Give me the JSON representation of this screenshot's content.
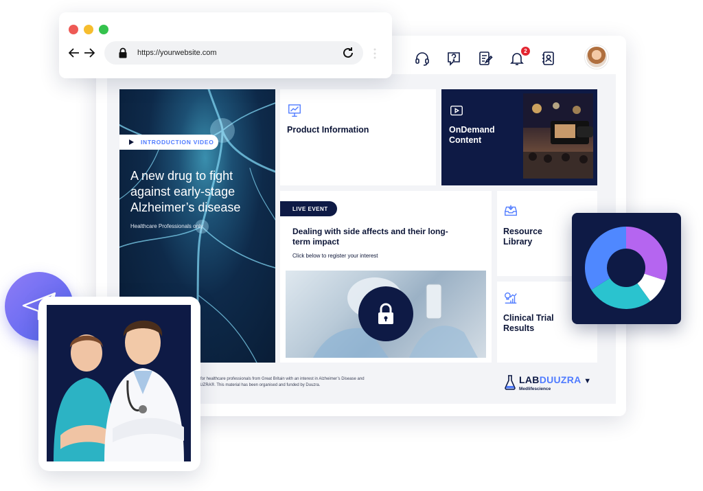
{
  "browser": {
    "url": "https://yourwebsite.com",
    "dots": [
      "#ee5a55",
      "#f6bd2e",
      "#35c24d"
    ],
    "icons": [
      "back-arrow-icon",
      "forward-arrow-icon",
      "lock-icon",
      "reload-icon"
    ]
  },
  "header": {
    "icons": [
      "headset-icon",
      "help-icon",
      "edit-notes-icon",
      "bell-icon",
      "contacts-icon"
    ],
    "notification_count": "2"
  },
  "hero": {
    "pill_label": "INTRODUCTION VIDEO",
    "title": "A new drug to fight against early-stage Alzheimer’s disease",
    "subtitle": "Healthcare Professionals only"
  },
  "tiles": {
    "product": {
      "label": "Product Information",
      "icon": "trend-chart-icon"
    },
    "ondemand": {
      "label": "OnDemand Content",
      "icon": "video-play-icon"
    },
    "resource": {
      "label": "Resource Library",
      "icon": "inbox-download-icon"
    },
    "clinical": {
      "label": "Clinical Trial Results",
      "icon": "bulb-chart-icon"
    }
  },
  "live_event": {
    "pill_label": "LIVE EVENT",
    "title": "Dealing with side affects and their long-term impact",
    "subtitle": "Click below to register your interest"
  },
  "footer": {
    "text_line1": "d for healthcare professionals from Great Britain with an interest in Alzheimer’s Disease and",
    "text_line2": "UUZRA®. This material has been organised and funded by Duuzra."
  },
  "brand": {
    "name_a": "LAB",
    "name_b": "DUUZRA",
    "tagline": "Medlifescience"
  },
  "donut": {
    "segments_pct": [
      30,
      10,
      26,
      34
    ],
    "colors": [
      "#b565f0",
      "#ffffff",
      "#2ac3cf",
      "#4f88ff"
    ]
  },
  "colors": {
    "navy": "#0e1a45",
    "accent_blue": "#4f7bff",
    "badge_red": "#e32531"
  }
}
